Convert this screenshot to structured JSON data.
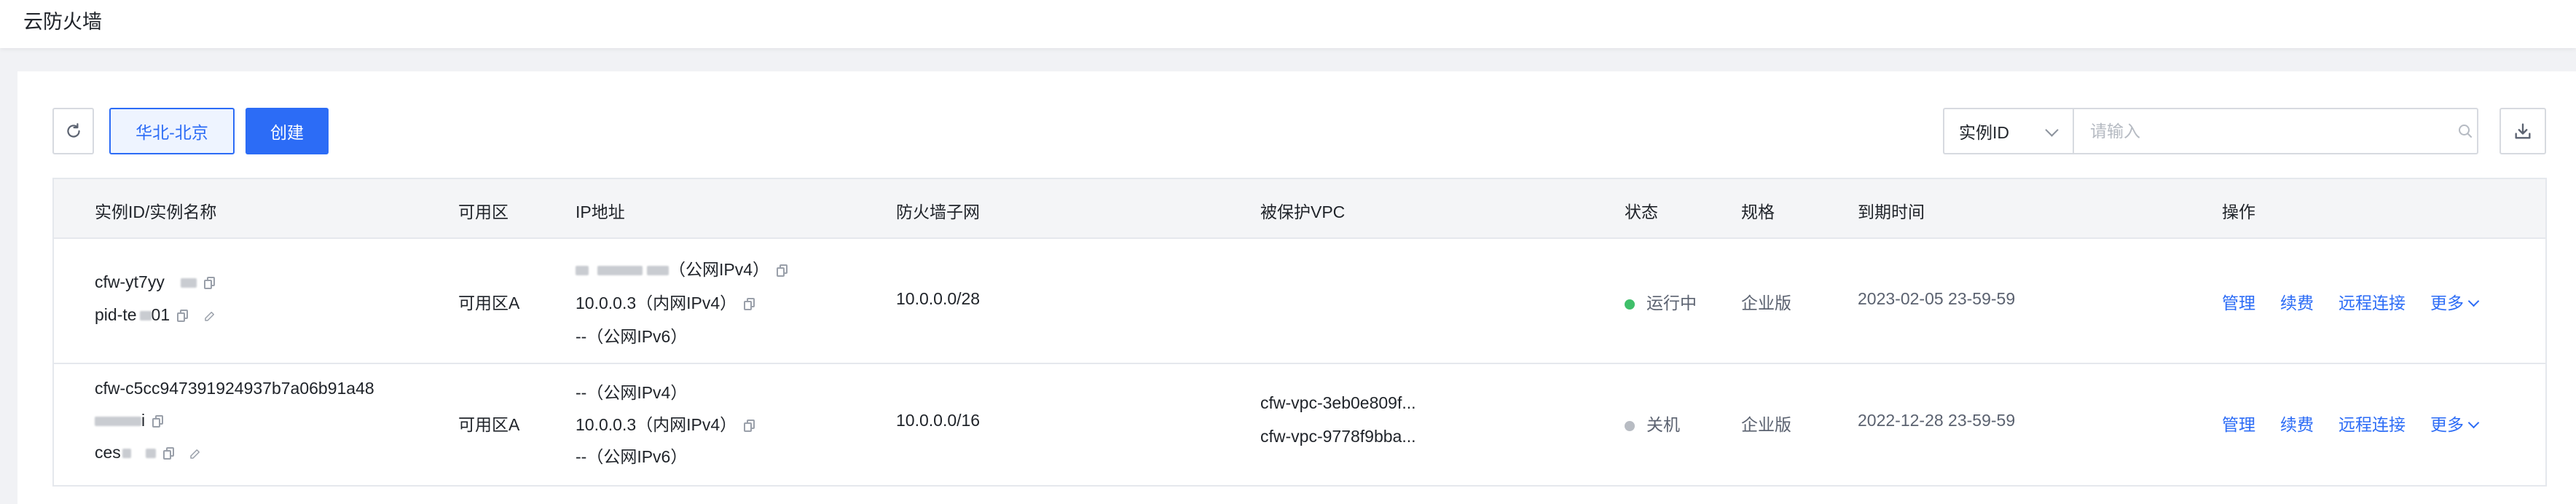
{
  "page": {
    "title": "云防火墙"
  },
  "toolbar": {
    "region_label": "华北-北京",
    "create_label": "创建",
    "search_field": "实例ID",
    "search_placeholder": "请输入"
  },
  "table": {
    "headers": {
      "id_name": "实例ID/实例名称",
      "zone": "可用区",
      "ip": "IP地址",
      "subnet": "防火墙子网",
      "vpc": "被保护VPC",
      "status": "状态",
      "spec": "规格",
      "expire": "到期时间",
      "actions": "操作"
    },
    "actions": {
      "manage": "管理",
      "renew": "续费",
      "remote": "远程连接",
      "more": "更多"
    },
    "rows": [
      {
        "id": "cfw-yt7yy",
        "name": "pid-te",
        "name_suffix": "01",
        "zone": "可用区A",
        "ip_public_v4": "（公网IPv4）",
        "ip_private_v4": "10.0.0.3（内网IPv4）",
        "ip_public_v6": "--（公网IPv6）",
        "subnet": "10.0.0.0/28",
        "status": "运行中",
        "status_color": "#3fbf6a",
        "spec": "企业版",
        "expire": "2023-02-05 23-59-59"
      },
      {
        "id": "cfw-c5cc947391924937b7a06b91a48",
        "id_line2_suffix": "i",
        "name": "ces",
        "zone": "可用区A",
        "ip_public_v4": "--（公网IPv4）",
        "ip_private_v4": "10.0.0.3（内网IPv4）",
        "ip_public_v6": "--（公网IPv6）",
        "subnet": "10.0.0.0/16",
        "vpc1": "cfw-vpc-3eb0e809f...",
        "vpc2": "cfw-vpc-9778f9bba...",
        "status": "关机",
        "status_color": "#b8bcc3",
        "spec": "企业版",
        "expire": "2022-12-28 23-59-59"
      }
    ]
  },
  "icons": {
    "refresh": "refresh-icon",
    "search": "search-icon",
    "download": "download-icon",
    "copy": "copy-icon",
    "edit": "edit-icon",
    "chevron": "chevron-down-icon"
  },
  "colors": {
    "accent": "#2c6cf6",
    "running": "#3fbf6a",
    "stopped": "#b8bcc3"
  }
}
